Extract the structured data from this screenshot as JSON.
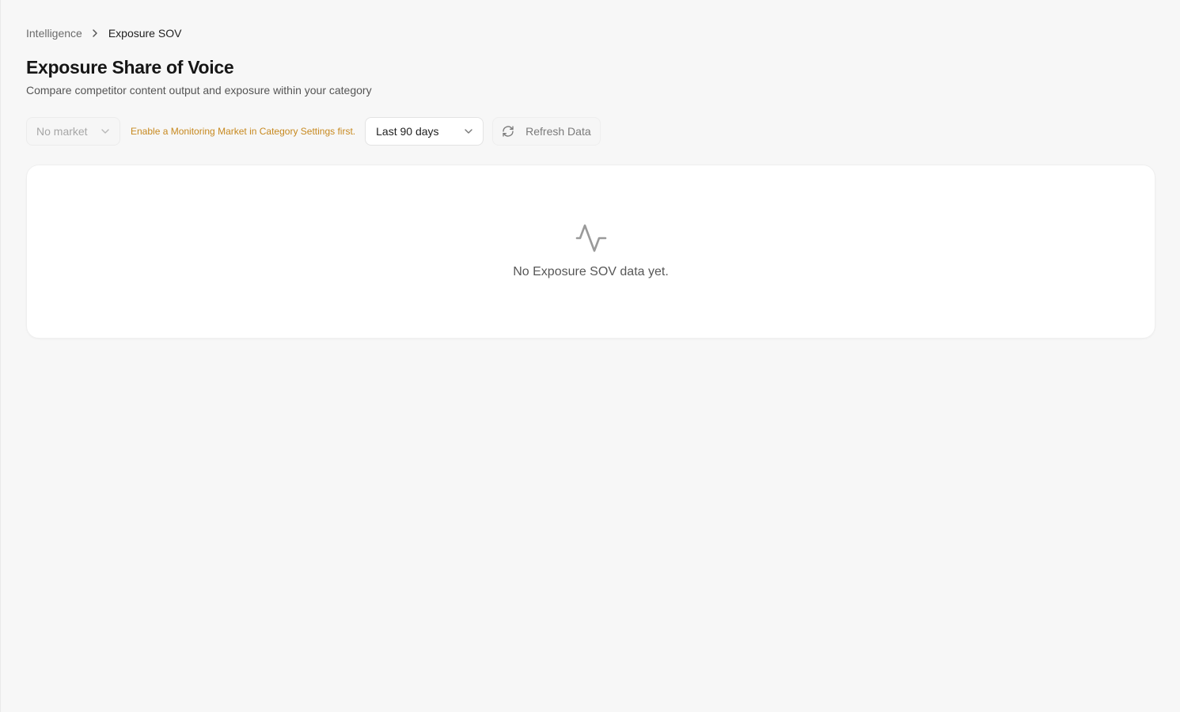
{
  "breadcrumb": {
    "parent": "Intelligence",
    "current": "Exposure SOV"
  },
  "header": {
    "title": "Exposure Share of Voice",
    "subtitle": "Compare competitor content output and exposure within your category"
  },
  "toolbar": {
    "market_select": {
      "value": "No market",
      "disabled": true
    },
    "market_warning": "Enable a Monitoring Market in Category Settings first.",
    "range_select": {
      "value": "Last 90 days"
    },
    "refresh_label": "Refresh Data"
  },
  "empty_state": {
    "icon": "activity-icon",
    "message": "No Exposure SOV data yet."
  },
  "colors": {
    "background": "#f7f7f7",
    "card": "#ffffff",
    "warning": "#c7891f",
    "muted_text": "#6b6b6b"
  }
}
